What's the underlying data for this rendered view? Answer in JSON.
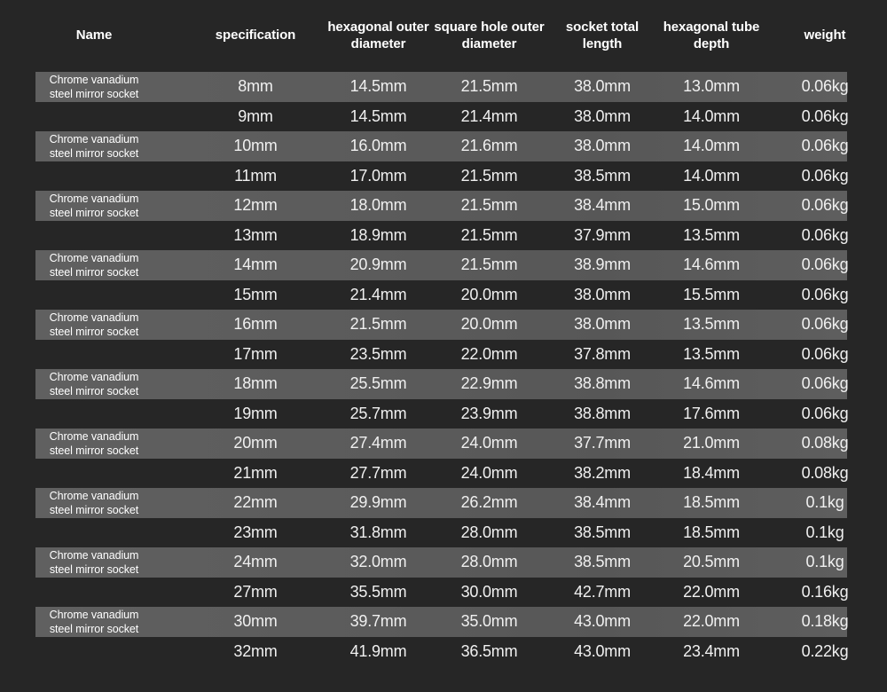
{
  "table": {
    "columns": [
      {
        "id": "name",
        "label": "Name"
      },
      {
        "id": "spec",
        "label": "specification"
      },
      {
        "id": "hex",
        "label": "hexagonal\nouter diameter"
      },
      {
        "id": "square",
        "label": "square hole\nouter diameter"
      },
      {
        "id": "length",
        "label": "socket total length"
      },
      {
        "id": "depth",
        "label": "hexagonal\ntube depth"
      },
      {
        "id": "weight",
        "label": "weight"
      }
    ],
    "name_value": "Chrome vanadium\nsteel mirror socket",
    "colors": {
      "background": "#262626",
      "row_highlight": "#5b5b5b",
      "text": "#f2f2f2",
      "header_text": "#ffffff"
    },
    "rows": [
      {
        "highlighted": true,
        "name": "Chrome vanadium\nsteel mirror socket",
        "spec": "8mm",
        "hex": "14.5mm",
        "square": "21.5mm",
        "length": "38.0mm",
        "depth": "13.0mm",
        "weight": "0.06kg"
      },
      {
        "highlighted": false,
        "name": "",
        "spec": "9mm",
        "hex": "14.5mm",
        "square": "21.4mm",
        "length": "38.0mm",
        "depth": "14.0mm",
        "weight": "0.06kg"
      },
      {
        "highlighted": true,
        "name": "Chrome vanadium\nsteel mirror socket",
        "spec": "10mm",
        "hex": "16.0mm",
        "square": "21.6mm",
        "length": "38.0mm",
        "depth": "14.0mm",
        "weight": "0.06kg"
      },
      {
        "highlighted": false,
        "name": "",
        "spec": "11mm",
        "hex": "17.0mm",
        "square": "21.5mm",
        "length": "38.5mm",
        "depth": "14.0mm",
        "weight": "0.06kg"
      },
      {
        "highlighted": true,
        "name": "Chrome vanadium\nsteel mirror socket",
        "spec": "12mm",
        "hex": "18.0mm",
        "square": "21.5mm",
        "length": "38.4mm",
        "depth": "15.0mm",
        "weight": "0.06kg"
      },
      {
        "highlighted": false,
        "name": "",
        "spec": "13mm",
        "hex": "18.9mm",
        "square": "21.5mm",
        "length": "37.9mm",
        "depth": "13.5mm",
        "weight": "0.06kg"
      },
      {
        "highlighted": true,
        "name": "Chrome vanadium\nsteel mirror socket",
        "spec": "14mm",
        "hex": "20.9mm",
        "square": "21.5mm",
        "length": "38.9mm",
        "depth": "14.6mm",
        "weight": "0.06kg"
      },
      {
        "highlighted": false,
        "name": "",
        "spec": "15mm",
        "hex": "21.4mm",
        "square": "20.0mm",
        "length": "38.0mm",
        "depth": "15.5mm",
        "weight": "0.06kg"
      },
      {
        "highlighted": true,
        "name": "Chrome vanadium\nsteel mirror socket",
        "spec": "16mm",
        "hex": "21.5mm",
        "square": "20.0mm",
        "length": "38.0mm",
        "depth": "13.5mm",
        "weight": "0.06kg"
      },
      {
        "highlighted": false,
        "name": "",
        "spec": "17mm",
        "hex": "23.5mm",
        "square": "22.0mm",
        "length": "37.8mm",
        "depth": "13.5mm",
        "weight": "0.06kg"
      },
      {
        "highlighted": true,
        "name": "Chrome vanadium\nsteel mirror socket",
        "spec": "18mm",
        "hex": "25.5mm",
        "square": "22.9mm",
        "length": "38.8mm",
        "depth": "14.6mm",
        "weight": "0.06kg"
      },
      {
        "highlighted": false,
        "name": "",
        "spec": "19mm",
        "hex": "25.7mm",
        "square": "23.9mm",
        "length": "38.8mm",
        "depth": "17.6mm",
        "weight": "0.06kg"
      },
      {
        "highlighted": true,
        "name": "Chrome vanadium\nsteel mirror socket",
        "spec": "20mm",
        "hex": "27.4mm",
        "square": "24.0mm",
        "length": "37.7mm",
        "depth": "21.0mm",
        "weight": "0.08kg"
      },
      {
        "highlighted": false,
        "name": "",
        "spec": "21mm",
        "hex": "27.7mm",
        "square": "24.0mm",
        "length": "38.2mm",
        "depth": "18.4mm",
        "weight": "0.08kg"
      },
      {
        "highlighted": true,
        "name": "Chrome vanadium\nsteel mirror socket",
        "spec": "22mm",
        "hex": "29.9mm",
        "square": "26.2mm",
        "length": "38.4mm",
        "depth": "18.5mm",
        "weight": "0.1kg"
      },
      {
        "highlighted": false,
        "name": "",
        "spec": "23mm",
        "hex": "31.8mm",
        "square": "28.0mm",
        "length": "38.5mm",
        "depth": "18.5mm",
        "weight": "0.1kg"
      },
      {
        "highlighted": true,
        "name": "Chrome vanadium\nsteel mirror socket",
        "spec": "24mm",
        "hex": "32.0mm",
        "square": "28.0mm",
        "length": "38.5mm",
        "depth": "20.5mm",
        "weight": "0.1kg"
      },
      {
        "highlighted": false,
        "name": "",
        "spec": "27mm",
        "hex": "35.5mm",
        "square": "30.0mm",
        "length": "42.7mm",
        "depth": "22.0mm",
        "weight": "0.16kg"
      },
      {
        "highlighted": true,
        "name": "Chrome vanadium\nsteel mirror socket",
        "spec": "30mm",
        "hex": "39.7mm",
        "square": "35.0mm",
        "length": "43.0mm",
        "depth": "22.0mm",
        "weight": "0.18kg"
      },
      {
        "highlighted": false,
        "name": "",
        "spec": "32mm",
        "hex": "41.9mm",
        "square": "36.5mm",
        "length": "43.0mm",
        "depth": "23.4mm",
        "weight": "0.22kg"
      }
    ]
  }
}
